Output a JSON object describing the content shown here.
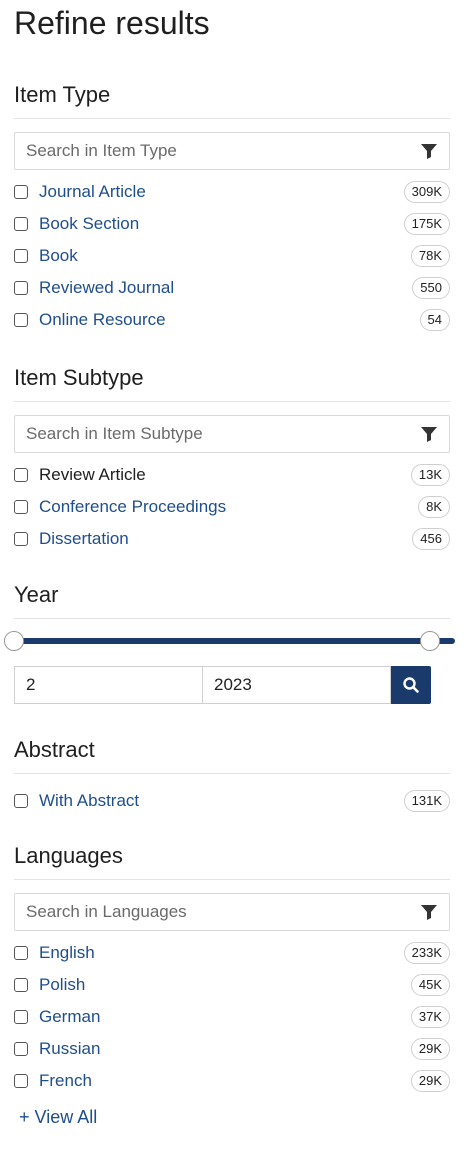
{
  "page_title": "Refine results",
  "item_type": {
    "title": "Item Type",
    "search_placeholder": "Search in Item Type",
    "items": [
      {
        "label": "Journal Article",
        "count": "309K"
      },
      {
        "label": "Book Section",
        "count": "175K"
      },
      {
        "label": "Book",
        "count": "78K"
      },
      {
        "label": "Reviewed Journal",
        "count": "550"
      },
      {
        "label": "Online Resource",
        "count": "54"
      }
    ]
  },
  "item_subtype": {
    "title": "Item Subtype",
    "search_placeholder": "Search in Item Subtype",
    "items": [
      {
        "label": "Review Article",
        "count": "13K"
      },
      {
        "label": "Conference Proceedings",
        "count": "8K"
      },
      {
        "label": "Dissertation",
        "count": "456"
      }
    ]
  },
  "year": {
    "title": "Year",
    "from_value": "2",
    "to_value": "2023"
  },
  "abstract": {
    "title": "Abstract",
    "items": [
      {
        "label": "With Abstract",
        "count": "131K"
      }
    ]
  },
  "languages": {
    "title": "Languages",
    "search_placeholder": "Search in Languages",
    "items": [
      {
        "label": "English",
        "count": "233K"
      },
      {
        "label": "Polish",
        "count": "45K"
      },
      {
        "label": "German",
        "count": "37K"
      },
      {
        "label": "Russian",
        "count": "29K"
      },
      {
        "label": "French",
        "count": "29K"
      }
    ],
    "view_all": "+ View All"
  },
  "colors": {
    "link": "#1f4e8c",
    "accent": "#1a3a6c"
  }
}
